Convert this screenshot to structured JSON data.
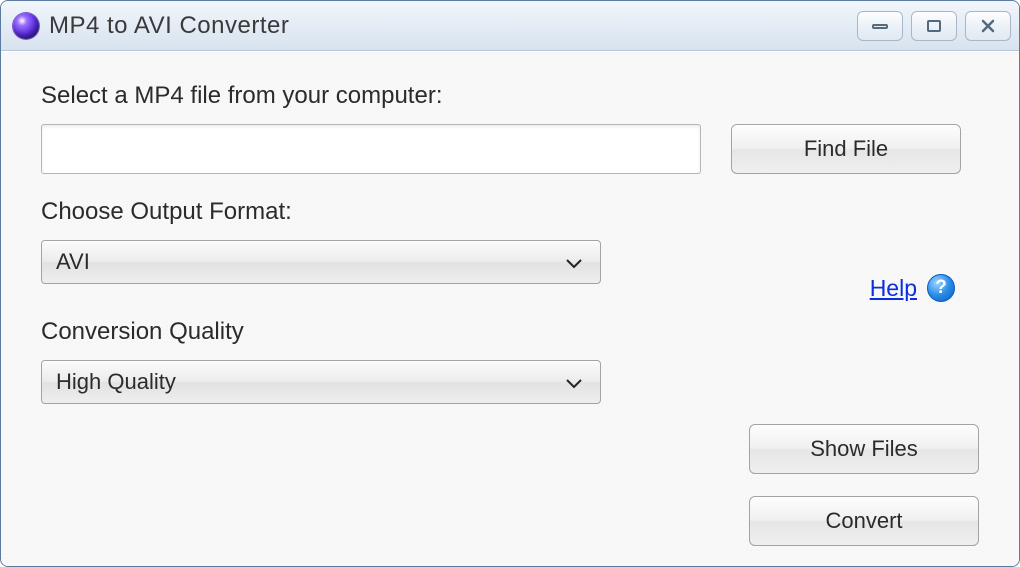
{
  "window": {
    "title": "MP4 to AVI Converter"
  },
  "labels": {
    "select_file": "Select a MP4 file from your computer:",
    "output_format": "Choose Output Format:",
    "quality": "Conversion Quality"
  },
  "inputs": {
    "file_path": ""
  },
  "selects": {
    "format_value": "AVI",
    "quality_value": "High Quality"
  },
  "buttons": {
    "find_file": "Find File",
    "show_files": "Show Files",
    "convert": "Convert"
  },
  "help": {
    "link_label": "Help",
    "icon_glyph": "?"
  }
}
